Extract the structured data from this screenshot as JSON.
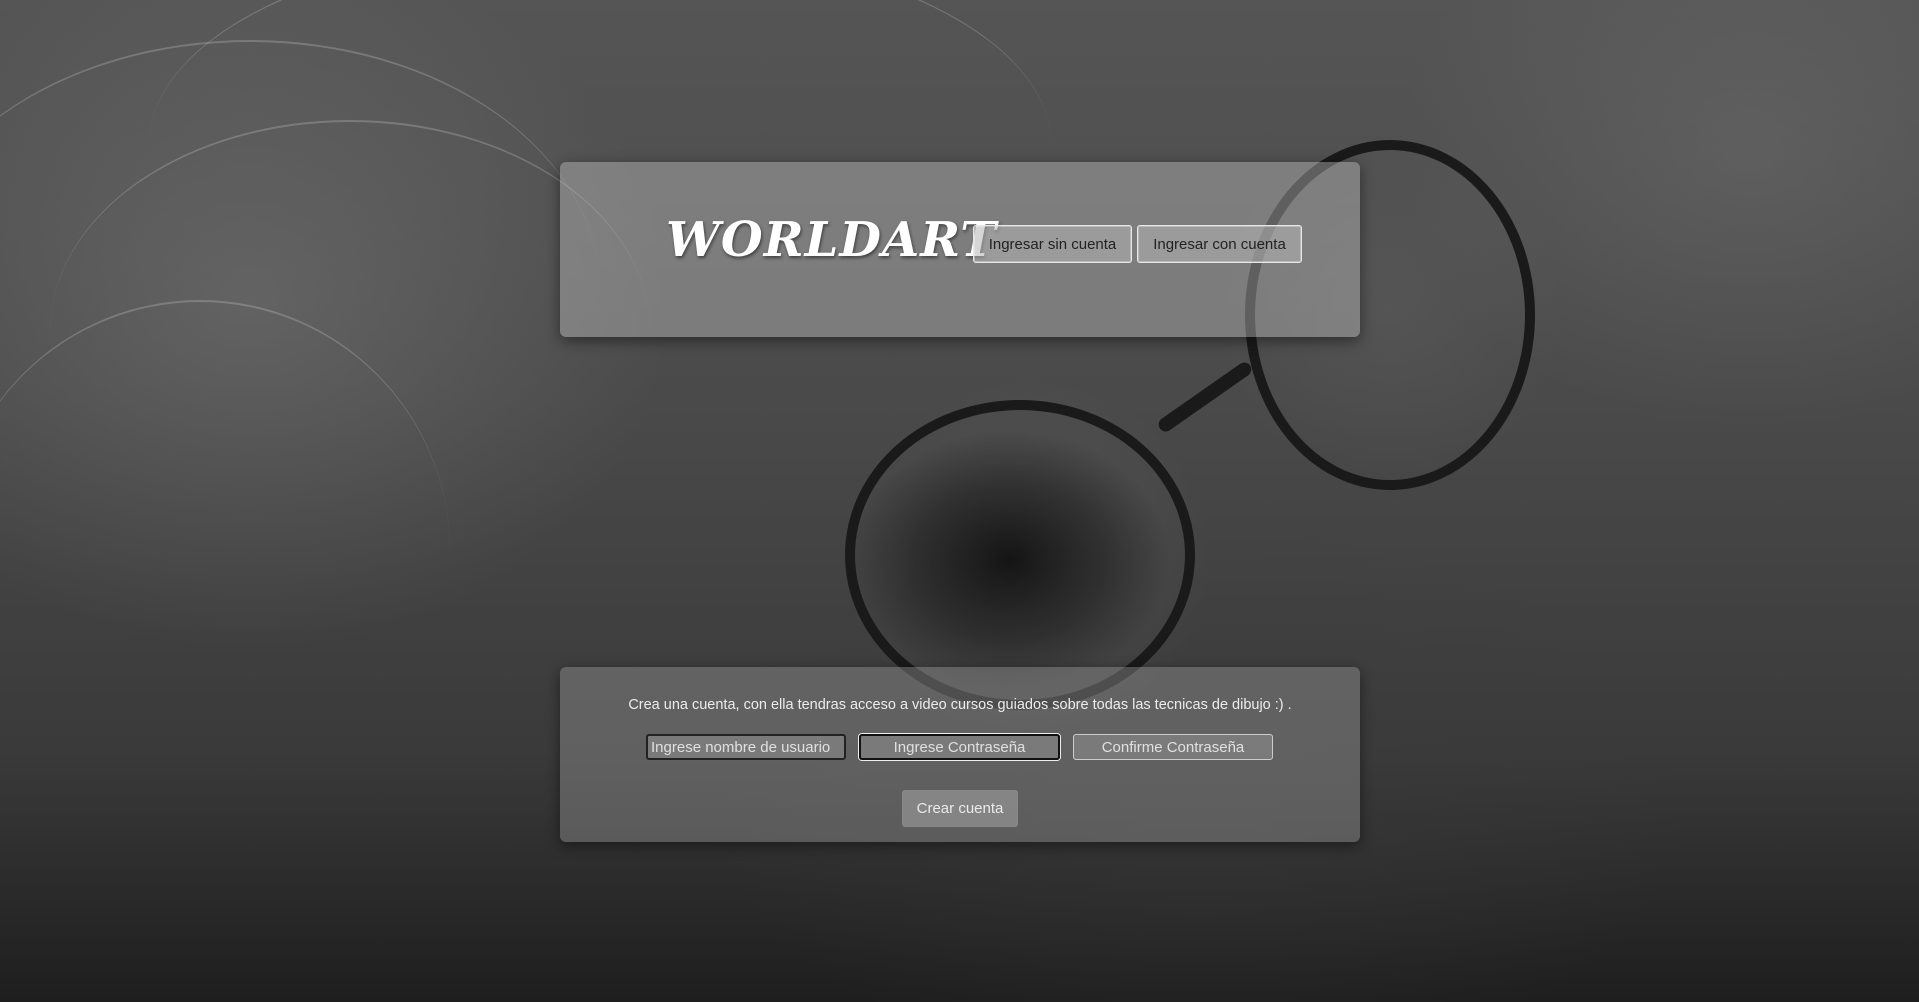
{
  "header": {
    "logo_text": "WORLDART",
    "guest_button": "Ingresar sin cuenta",
    "login_button": "Ingresar con cuenta"
  },
  "signup": {
    "info_text": "Crea una cuenta, con ella tendras acceso a video cursos guiados sobre todas las tecnicas de dibujo :) .",
    "username_placeholder": "Ingrese nombre de usuario",
    "password_placeholder": "Ingrese Contraseña",
    "confirm_placeholder": "Confirme Contraseña",
    "create_button": "Crear cuenta"
  }
}
